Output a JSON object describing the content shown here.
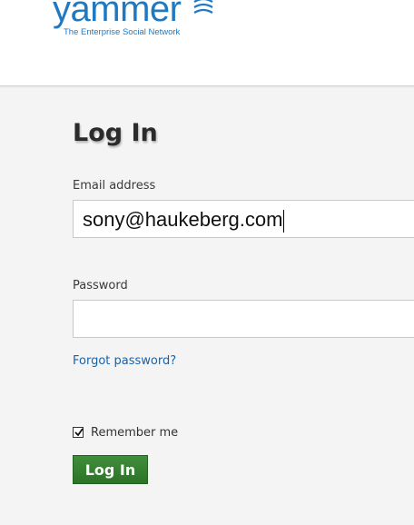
{
  "brand": {
    "name": "yammer",
    "tagline": "The Enterprise Social Network",
    "color": "#1f78c0",
    "icon": "yammer-waves-icon"
  },
  "form": {
    "title": "Log In",
    "email_label": "Email address",
    "email_value": "sony@haukeberg.com",
    "password_label": "Password",
    "password_value": "",
    "forgot_link": "Forgot password?",
    "remember_label": "Remember me",
    "remember_checked": true,
    "submit_label": "Log In"
  },
  "colors": {
    "button": "#2f7a2c",
    "link": "#1a62a8"
  }
}
